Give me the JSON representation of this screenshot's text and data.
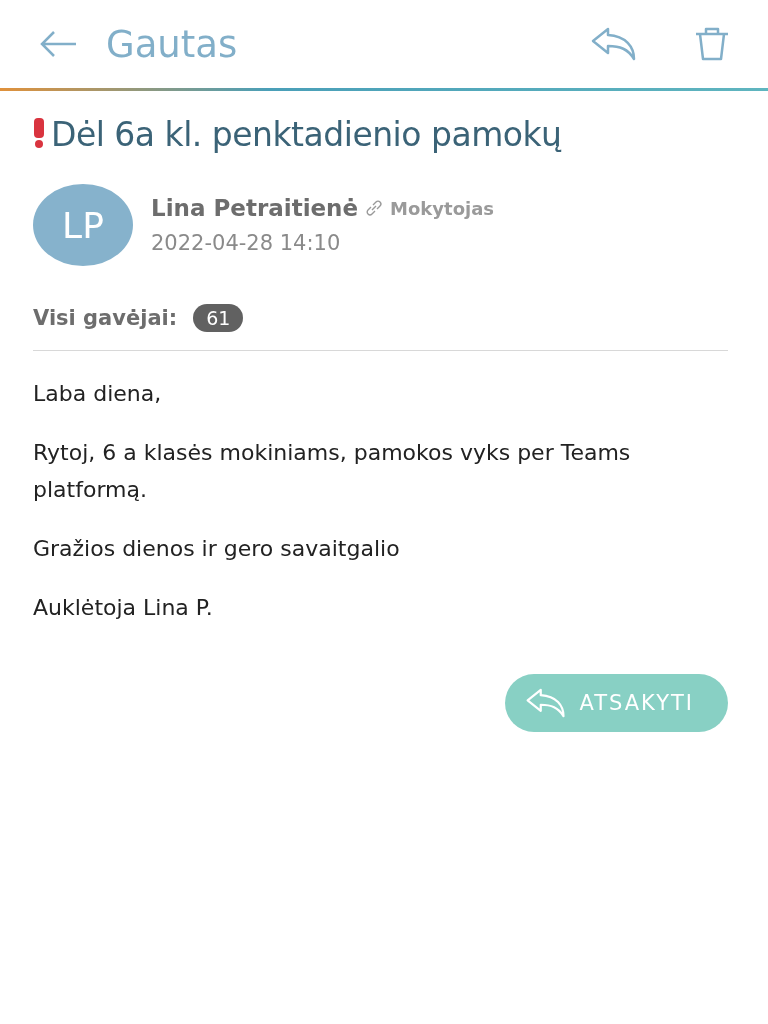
{
  "header": {
    "title": "Gautas"
  },
  "message": {
    "important": true,
    "subject": "Dėl 6a kl. penktadienio pamokų",
    "sender": {
      "initials": "LP",
      "name": "Lina Petraitienė",
      "role": "Mokytojas",
      "date": "2022-04-28 14:10"
    },
    "recipients": {
      "label": "Visi gavėjai:",
      "count": "61"
    },
    "body": [
      "Laba diena,",
      "Rytoj, 6 a klasės mokiniams, pamokos vyks per Teams platformą.",
      "Gražios dienos ir gero savaitgalio",
      "Auklėtoja Lina P."
    ]
  },
  "reply_button": {
    "label": "ATSAKYTI"
  }
}
